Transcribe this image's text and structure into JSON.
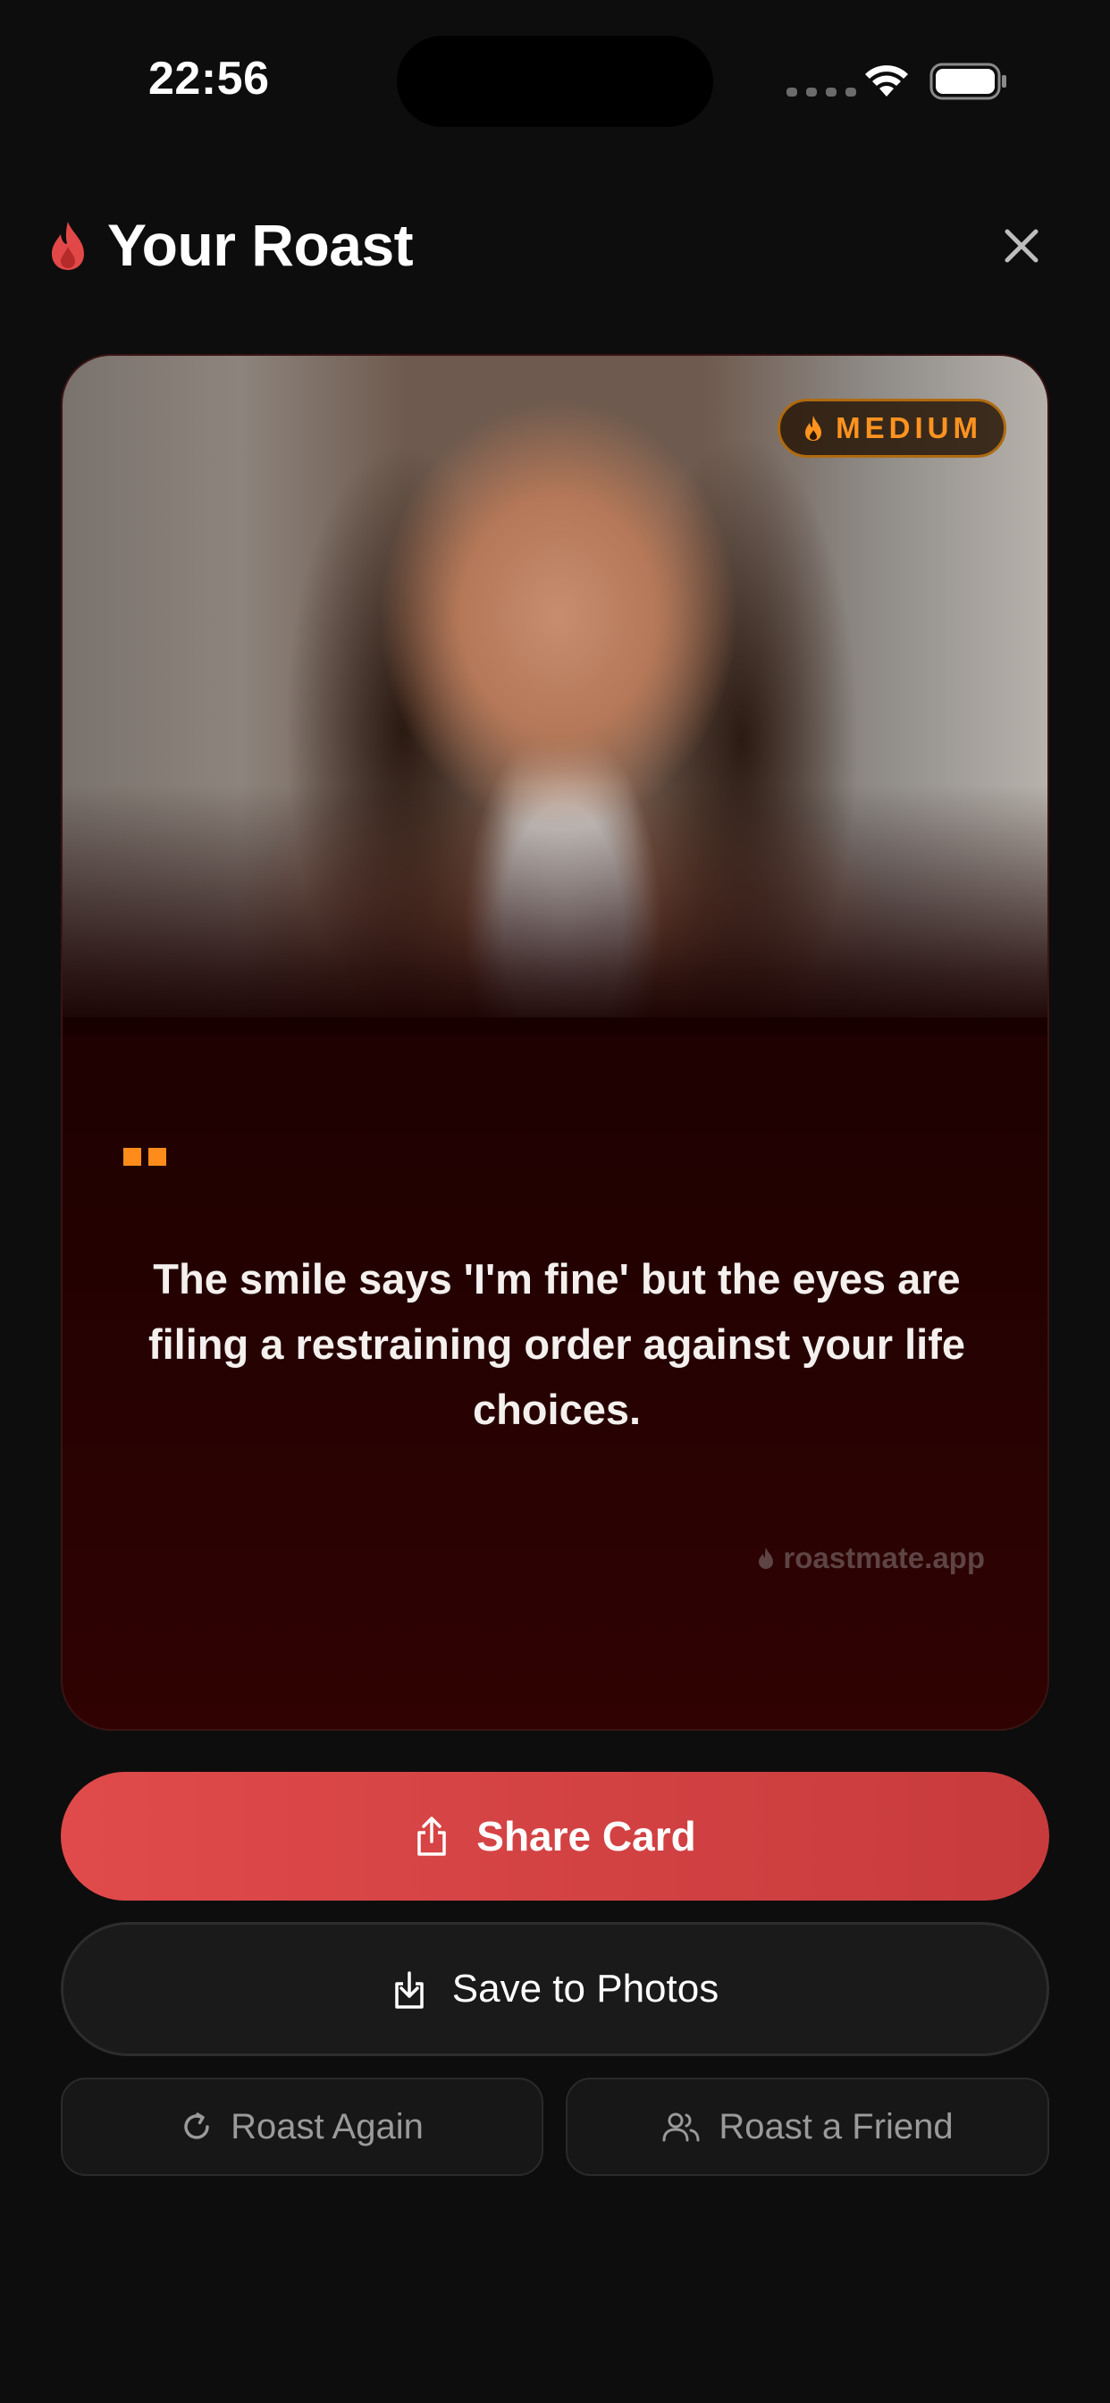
{
  "status_bar": {
    "time": "22:56"
  },
  "header": {
    "title": "Your Roast",
    "title_icon": "flame-icon",
    "close_icon": "close-icon"
  },
  "card": {
    "photo_description_icon": "selfie-photo",
    "heat_level": "MEDIUM",
    "roast_text": "The smile says 'I'm fine' but the eyes are filing a restraining order against your life choices.",
    "watermark": "roastmate.app"
  },
  "actions": {
    "share_label": "Share Card",
    "save_label": "Save to Photos",
    "roast_again_label": "Roast Again",
    "roast_friend_label": "Roast a Friend"
  },
  "colors": {
    "accent_red": "#e04a4a",
    "badge_orange": "#ff9320",
    "background": "#0d0d0d",
    "card_dark_red": "#200101"
  }
}
